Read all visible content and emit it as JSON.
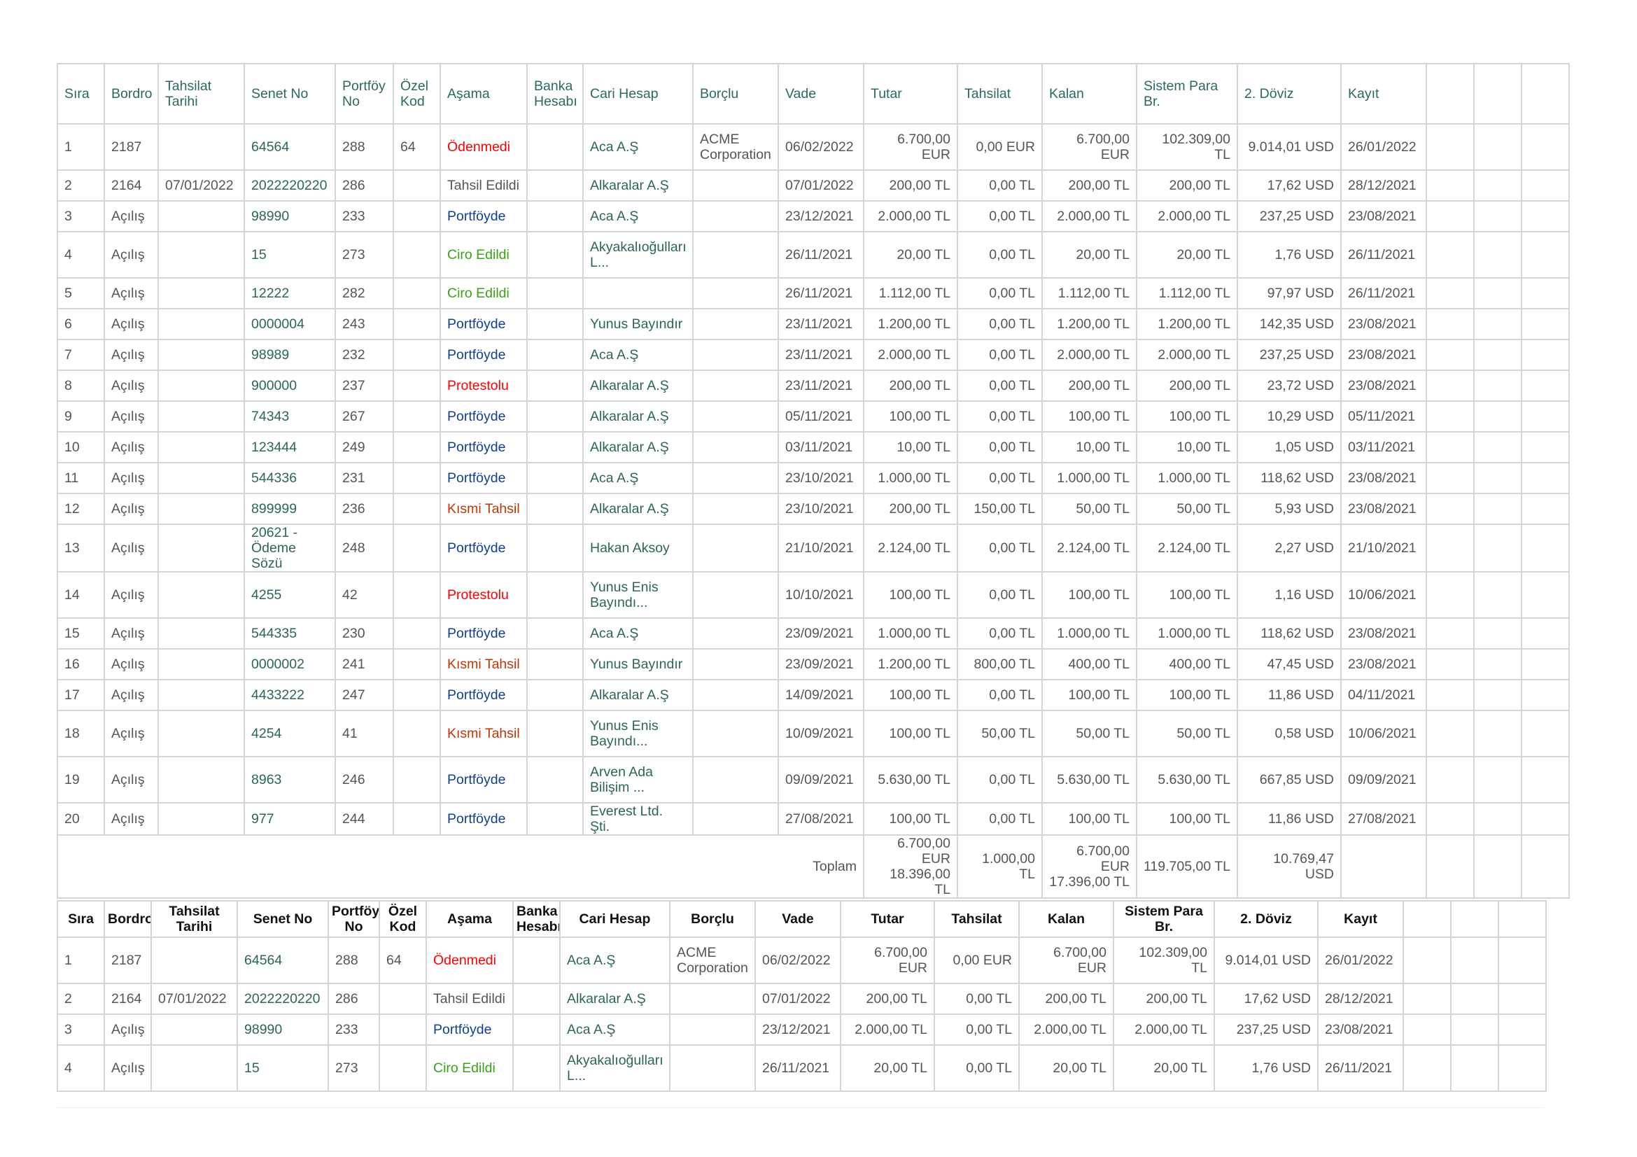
{
  "columns": [
    "Sıra",
    "Bordro",
    "Tahsilat Tarihi",
    "Senet No",
    "Portföy No",
    "Özel Kod",
    "Aşama",
    "Banka Hesabı",
    "Cari Hesap",
    "Borçlu",
    "Vade",
    "Tutar",
    "Tahsilat",
    "Kalan",
    "Sistem Para Br.",
    "2. Döviz",
    "Kayıt"
  ],
  "rows": [
    [
      "1",
      "2187",
      "",
      "64564",
      "288",
      "64",
      "Ödenmedi",
      "",
      "Aca A.Ş",
      "ACME Corporation",
      "06/02/2022",
      "6.700,00 EUR",
      "0,00 EUR",
      "6.700,00 EUR",
      "102.309,00 TL",
      "9.014,01 USD",
      "26/01/2022"
    ],
    [
      "2",
      "2164",
      "07/01/2022",
      "2022220220",
      "286",
      "",
      "Tahsil Edildi",
      "",
      "Alkaralar A.Ş",
      "",
      "07/01/2022",
      "200,00 TL",
      "0,00 TL",
      "200,00 TL",
      "200,00 TL",
      "17,62 USD",
      "28/12/2021"
    ],
    [
      "3",
      "Açılış",
      "",
      "98990",
      "233",
      "",
      "Portföyde",
      "",
      "Aca A.Ş",
      "",
      "23/12/2021",
      "2.000,00 TL",
      "0,00 TL",
      "2.000,00 TL",
      "2.000,00 TL",
      "237,25 USD",
      "23/08/2021"
    ],
    [
      "4",
      "Açılış",
      "",
      "15",
      "273",
      "",
      "Ciro Edildi",
      "",
      "Akyakalıoğulları L...",
      "",
      "26/11/2021",
      "20,00 TL",
      "0,00 TL",
      "20,00 TL",
      "20,00 TL",
      "1,76 USD",
      "26/11/2021"
    ],
    [
      "5",
      "Açılış",
      "",
      "12222",
      "282",
      "",
      "Ciro Edildi",
      "",
      "",
      "",
      "26/11/2021",
      "1.112,00 TL",
      "0,00 TL",
      "1.112,00 TL",
      "1.112,00 TL",
      "97,97 USD",
      "26/11/2021"
    ],
    [
      "6",
      "Açılış",
      "",
      "0000004",
      "243",
      "",
      "Portföyde",
      "",
      "Yunus Bayındır",
      "",
      "23/11/2021",
      "1.200,00 TL",
      "0,00 TL",
      "1.200,00 TL",
      "1.200,00 TL",
      "142,35 USD",
      "23/08/2021"
    ],
    [
      "7",
      "Açılış",
      "",
      "98989",
      "232",
      "",
      "Portföyde",
      "",
      "Aca A.Ş",
      "",
      "23/11/2021",
      "2.000,00 TL",
      "0,00 TL",
      "2.000,00 TL",
      "2.000,00 TL",
      "237,25 USD",
      "23/08/2021"
    ],
    [
      "8",
      "Açılış",
      "",
      "900000",
      "237",
      "",
      "Protestolu",
      "",
      "Alkaralar A.Ş",
      "",
      "23/11/2021",
      "200,00 TL",
      "0,00 TL",
      "200,00 TL",
      "200,00 TL",
      "23,72 USD",
      "23/08/2021"
    ],
    [
      "9",
      "Açılış",
      "",
      "74343",
      "267",
      "",
      "Portföyde",
      "",
      "Alkaralar A.Ş",
      "",
      "05/11/2021",
      "100,00 TL",
      "0,00 TL",
      "100,00 TL",
      "100,00 TL",
      "10,29 USD",
      "05/11/2021"
    ],
    [
      "10",
      "Açılış",
      "",
      "123444",
      "249",
      "",
      "Portföyde",
      "",
      "Alkaralar A.Ş",
      "",
      "03/11/2021",
      "10,00 TL",
      "0,00 TL",
      "10,00 TL",
      "10,00 TL",
      "1,05 USD",
      "03/11/2021"
    ],
    [
      "11",
      "Açılış",
      "",
      "544336",
      "231",
      "",
      "Portföyde",
      "",
      "Aca A.Ş",
      "",
      "23/10/2021",
      "1.000,00 TL",
      "0,00 TL",
      "1.000,00 TL",
      "1.000,00 TL",
      "118,62 USD",
      "23/08/2021"
    ],
    [
      "12",
      "Açılış",
      "",
      "899999",
      "236",
      "",
      "Kısmi Tahsil",
      "",
      "Alkaralar A.Ş",
      "",
      "23/10/2021",
      "200,00 TL",
      "150,00 TL",
      "50,00 TL",
      "50,00 TL",
      "5,93 USD",
      "23/08/2021"
    ],
    [
      "13",
      "Açılış",
      "",
      "20621 - Ödeme Sözü",
      "248",
      "",
      "Portföyde",
      "",
      "Hakan Aksoy",
      "",
      "21/10/2021",
      "2.124,00 TL",
      "0,00 TL",
      "2.124,00 TL",
      "2.124,00 TL",
      "2,27 USD",
      "21/10/2021"
    ],
    [
      "14",
      "Açılış",
      "",
      "4255",
      "42",
      "",
      "Protestolu",
      "",
      "Yunus Enis Bayındı...",
      "",
      "10/10/2021",
      "100,00 TL",
      "0,00 TL",
      "100,00 TL",
      "100,00 TL",
      "1,16 USD",
      "10/06/2021"
    ],
    [
      "15",
      "Açılış",
      "",
      "544335",
      "230",
      "",
      "Portföyde",
      "",
      "Aca A.Ş",
      "",
      "23/09/2021",
      "1.000,00 TL",
      "0,00 TL",
      "1.000,00 TL",
      "1.000,00 TL",
      "118,62 USD",
      "23/08/2021"
    ],
    [
      "16",
      "Açılış",
      "",
      "0000002",
      "241",
      "",
      "Kısmi Tahsil",
      "",
      "Yunus Bayındır",
      "",
      "23/09/2021",
      "1.200,00 TL",
      "800,00 TL",
      "400,00 TL",
      "400,00 TL",
      "47,45 USD",
      "23/08/2021"
    ],
    [
      "17",
      "Açılış",
      "",
      "4433222",
      "247",
      "",
      "Portföyde",
      "",
      "Alkaralar A.Ş",
      "",
      "14/09/2021",
      "100,00 TL",
      "0,00 TL",
      "100,00 TL",
      "100,00 TL",
      "11,86 USD",
      "04/11/2021"
    ],
    [
      "18",
      "Açılış",
      "",
      "4254",
      "41",
      "",
      "Kısmi Tahsil",
      "",
      "Yunus Enis Bayındı...",
      "",
      "10/09/2021",
      "100,00 TL",
      "50,00 TL",
      "50,00 TL",
      "50,00 TL",
      "0,58 USD",
      "10/06/2021"
    ],
    [
      "19",
      "Açılış",
      "",
      "8963",
      "246",
      "",
      "Portföyde",
      "",
      "Arven Ada Bilişim ...",
      "",
      "09/09/2021",
      "5.630,00 TL",
      "0,00 TL",
      "5.630,00 TL",
      "5.630,00 TL",
      "667,85 USD",
      "09/09/2021"
    ],
    [
      "20",
      "Açılış",
      "",
      "977",
      "244",
      "",
      "Portföyde",
      "",
      "Everest Ltd. Şti.",
      "",
      "27/08/2021",
      "100,00 TL",
      "0,00 TL",
      "100,00 TL",
      "100,00 TL",
      "11,86 USD",
      "27/08/2021"
    ]
  ],
  "totals": {
    "label": "Toplam",
    "tutar_eur": "6.700,00 EUR",
    "tutar_tl": "18.396,00 TL",
    "tahsilat": "1.000,00 TL",
    "kalan_eur": "6.700,00 EUR",
    "kalan_tl": "17.396,00 TL",
    "sistem": "119.705,00 TL",
    "doviz": "10.769,47 USD"
  },
  "stage_colors": {
    "Ödenmedi": "#ff0000",
    "Protestolu": "#ff0000",
    "Portföyde": "#12408f",
    "Ciro Edildi": "#3ca019",
    "Kısmi Tahsil": "#bd3706",
    "Tahsil Edildi": "#555555"
  },
  "second_table_row_count": 4
}
